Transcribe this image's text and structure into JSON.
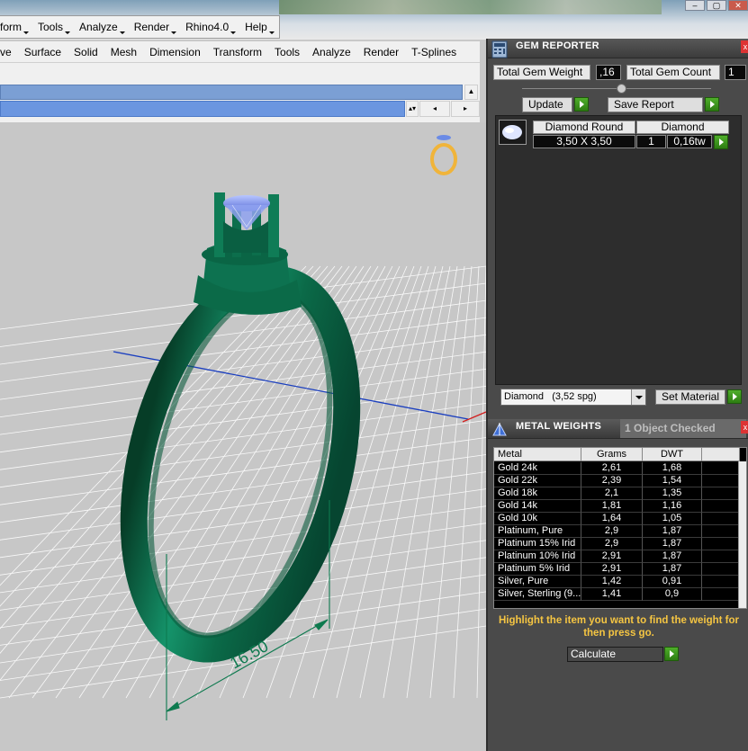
{
  "os_menu": {
    "items": [
      "form",
      "Tools",
      "Analyze",
      "Render",
      "Rhino4.0",
      "Help"
    ]
  },
  "rhino_menu": {
    "items": [
      "ve",
      "Surface",
      "Solid",
      "Mesh",
      "Dimension",
      "Transform",
      "Tools",
      "Analyze",
      "Render",
      "T-Splines"
    ]
  },
  "viewport": {
    "dimension_label": "16.50",
    "colors": {
      "ring": "#0e6a47",
      "stone": "#7b93e8",
      "grid": "#ffffff",
      "background": "#c7c7c7",
      "dimension": "#0e7a4f"
    }
  },
  "gem_reporter": {
    "title": "GEM REPORTER",
    "total_weight_label": "Total Gem Weight",
    "total_weight_value": ",16",
    "total_count_label": "Total Gem Count",
    "total_count_value": "1",
    "update_label": "Update",
    "save_report_label": "Save Report",
    "gems": [
      {
        "shape": "Diamond Round",
        "material": "Diamond",
        "size": "3,50 X 3,50",
        "count": "1",
        "weight": "0,16tw"
      }
    ],
    "material_select": "Diamond   (3,52 spg)",
    "set_material_label": "Set Material"
  },
  "metal_weights": {
    "title": "METAL WEIGHTS",
    "status": "1 Object Checked",
    "columns": [
      "Metal",
      "Grams",
      "DWT"
    ],
    "rows": [
      [
        "Gold 24k",
        "2,61",
        "1,68"
      ],
      [
        "Gold 22k",
        "2,39",
        "1,54"
      ],
      [
        "Gold 18k",
        "2,1",
        "1,35"
      ],
      [
        "Gold 14k",
        "1,81",
        "1,16"
      ],
      [
        "Gold 10k",
        "1,64",
        "1,05"
      ],
      [
        "Platinum, Pure",
        "2,9",
        "1,87"
      ],
      [
        "Platinum 15% Irid",
        "2,9",
        "1,87"
      ],
      [
        "Platinum 10% Irid",
        "2,91",
        "1,87"
      ],
      [
        "Platinum 5% Irid",
        "2,91",
        "1,87"
      ],
      [
        "Silver, Pure",
        "1,42",
        "0,91"
      ],
      [
        "Silver, Sterling (9...",
        "1,41",
        "0,9"
      ]
    ],
    "hint": "Highlight the item you want to find the weight for then press go.",
    "calculate_label": "Calculate"
  }
}
